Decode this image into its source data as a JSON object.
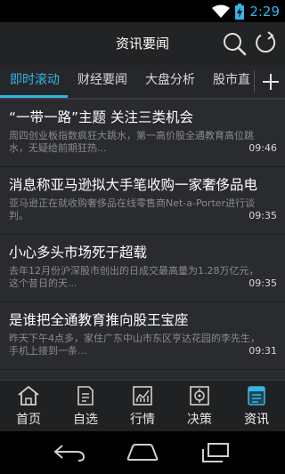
{
  "status": {
    "time": "2:29"
  },
  "header": {
    "title": "资讯要闻"
  },
  "tabs": [
    {
      "label": "即时滚动",
      "active": true
    },
    {
      "label": "财经要闻",
      "active": false
    },
    {
      "label": "大盘分析",
      "active": false
    },
    {
      "label": "股市直",
      "active": false
    }
  ],
  "news": [
    {
      "title": "“一带一路”主题 关注三类机会",
      "summary": "周四创业板指数疯狂大跳水，第一高价股全通教育高位跳水，无疑给前期狂热...",
      "time": "09:46"
    },
    {
      "title": "消息称亚马逊拟大手笔收购一家奢侈品电",
      "summary": "亚马逊正在就收购奢侈品在线零售商Net-a-Porter进行谈判。",
      "time": "09:35"
    },
    {
      "title": "小心多头市场死于超载",
      "summary": "去年12月份沪深股市创出的日成交最高量为1.28万亿元，这个昔日的天...",
      "time": "09:35"
    },
    {
      "title": "是谁把全通教育推向股王宝座",
      "summary": "昨天下午4点多，家住广东中山市东区亨达花园的李先生，手机上接到一条...",
      "time": "09:31"
    }
  ],
  "bottom_nav": [
    {
      "label": "首页",
      "icon": "home-icon",
      "active": false
    },
    {
      "label": "自选",
      "icon": "portfolio-icon",
      "active": false
    },
    {
      "label": "行情",
      "icon": "market-chart-icon",
      "active": false
    },
    {
      "label": "决策",
      "icon": "decision-target-icon",
      "active": false
    },
    {
      "label": "资讯",
      "icon": "news-icon",
      "active": true
    }
  ],
  "colors": {
    "accent": "#33b5e5",
    "background": "#2a2b2e",
    "bar": "#222325"
  }
}
